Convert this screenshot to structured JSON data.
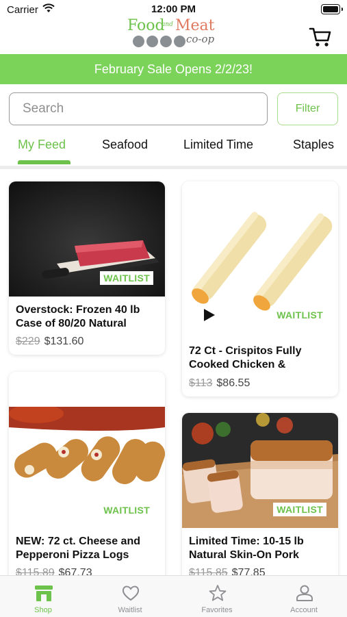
{
  "status_bar": {
    "carrier": "Carrier",
    "time": "12:00 PM"
  },
  "logo": {
    "word1": "Food",
    "word2": "and",
    "word3": "Meat",
    "word4": "co-op"
  },
  "banner": {
    "text": "February Sale Opens 2/2/23!"
  },
  "search": {
    "placeholder": "Search",
    "filter_label": "Filter"
  },
  "tabs": [
    {
      "label": "My Feed",
      "active": true
    },
    {
      "label": "Seafood",
      "active": false
    },
    {
      "label": "Limited Time",
      "active": false
    },
    {
      "label": "Staples",
      "active": false
    }
  ],
  "products": [
    {
      "title": "Overstock: Frozen 40 lb Case of 80/20 Natural",
      "old_price": "$229",
      "price": "$131.60",
      "badge": "WAITLIST"
    },
    {
      "title": "72 Ct - Crispitos Fully Cooked Chicken &",
      "old_price": "$113",
      "price": "$86.55",
      "badge": "WAITLIST"
    },
    {
      "title": "NEW: 72 ct. Cheese and Pepperoni Pizza Logs",
      "old_price": "$115.89",
      "price": "$67.73",
      "badge": "WAITLIST"
    },
    {
      "title": "Limited Time: 10-15 lb Natural Skin-On Pork",
      "old_price": "$115.85",
      "price": "$77.85",
      "badge": "WAITLIST"
    }
  ],
  "tab_bar": [
    {
      "label": "Shop",
      "icon": "shop-icon",
      "active": true
    },
    {
      "label": "Waitlist",
      "icon": "heart-icon",
      "active": false
    },
    {
      "label": "Favorites",
      "icon": "star-icon",
      "active": false
    },
    {
      "label": "Account",
      "icon": "person-icon",
      "active": false
    }
  ],
  "colors": {
    "accent": "#6cc24a",
    "banner": "#7bd35a",
    "price_old": "#999999",
    "text": "#111111"
  }
}
